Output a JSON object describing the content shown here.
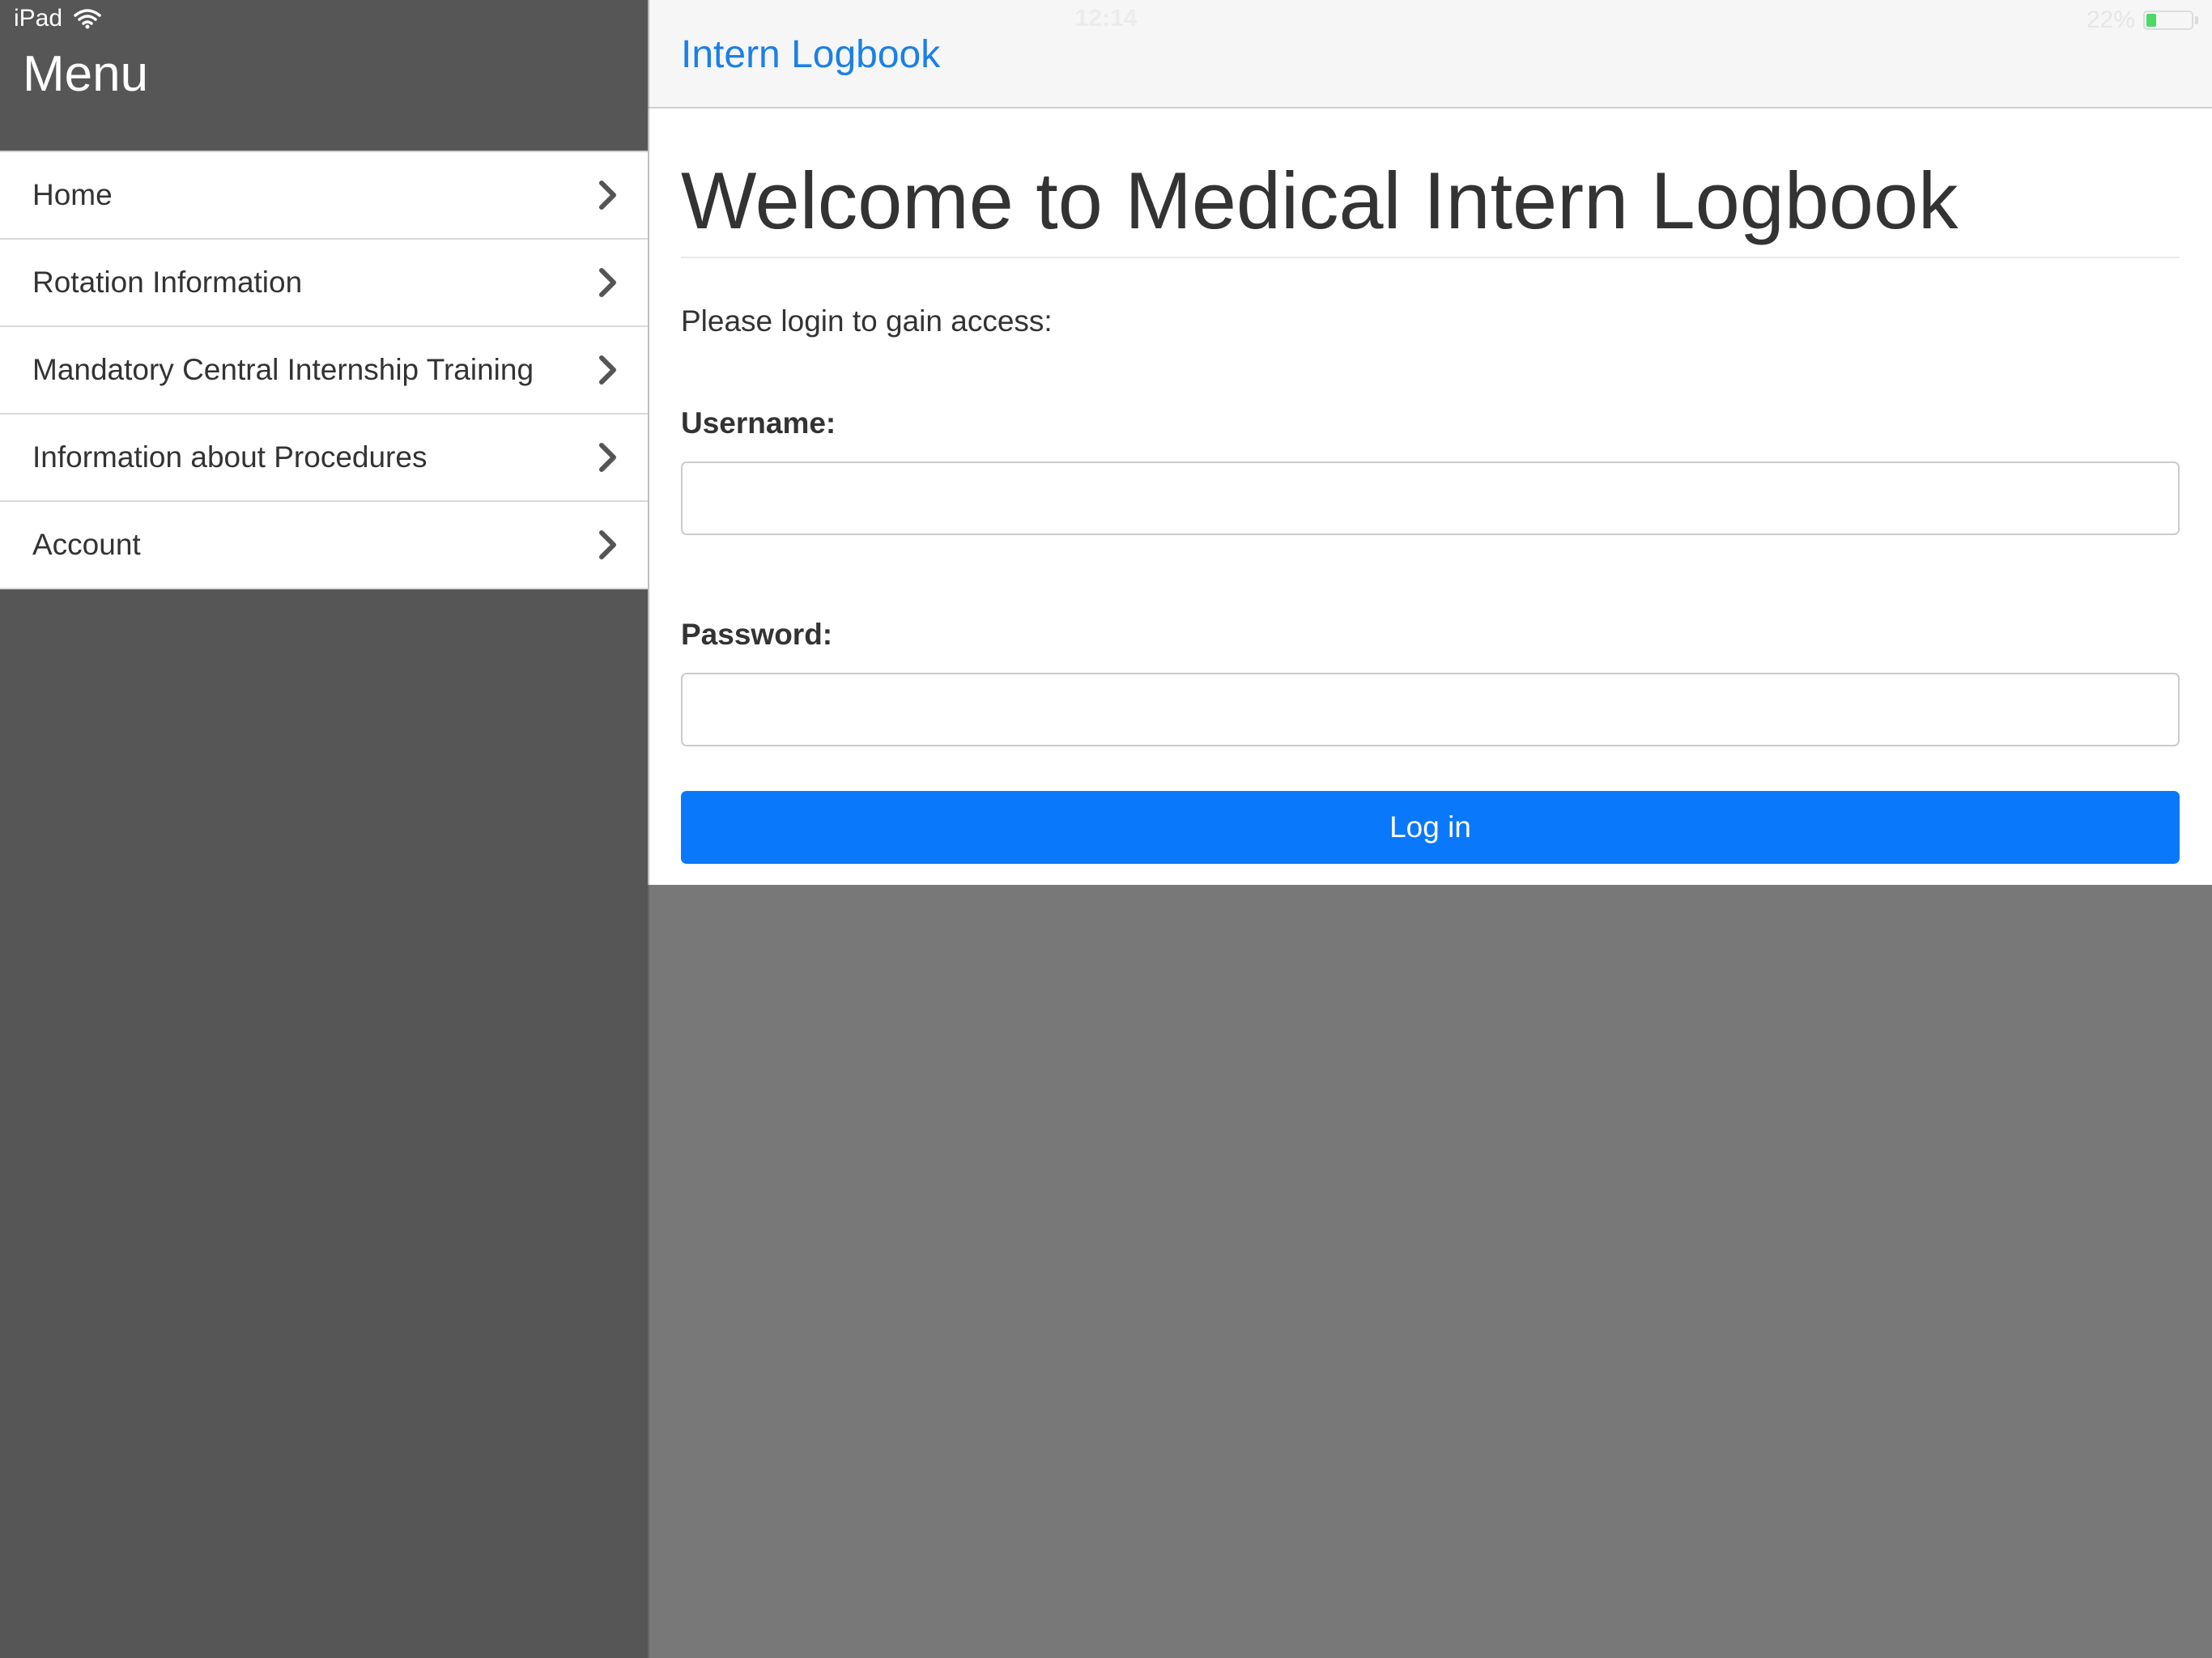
{
  "status_bar": {
    "device_label": "iPad",
    "wifi_icon": "wifi-icon",
    "time": "12:14",
    "battery_percent": "22%",
    "battery_level": 0.22,
    "battery_color": "#4cd964"
  },
  "sidebar": {
    "title": "Menu",
    "items": [
      {
        "label": "Home",
        "icon": "chevron-right-icon"
      },
      {
        "label": "Rotation Information",
        "icon": "chevron-right-icon"
      },
      {
        "label": "Mandatory Central Internship Training",
        "icon": "chevron-right-icon"
      },
      {
        "label": "Information about Procedures",
        "icon": "chevron-right-icon"
      },
      {
        "label": "Account",
        "icon": "chevron-right-icon"
      }
    ]
  },
  "header": {
    "title": "Intern Logbook"
  },
  "main": {
    "heading": "Welcome to Medical Intern Logbook",
    "intro": "Please login to gain access:",
    "username": {
      "label": "Username:",
      "value": ""
    },
    "password": {
      "label": "Password:",
      "value": ""
    },
    "login_button_label": "Log in"
  },
  "colors": {
    "accent": "#0a78fa",
    "link": "#1a80e6",
    "sidebar_bg": "#565656",
    "backdrop": "#787878"
  }
}
